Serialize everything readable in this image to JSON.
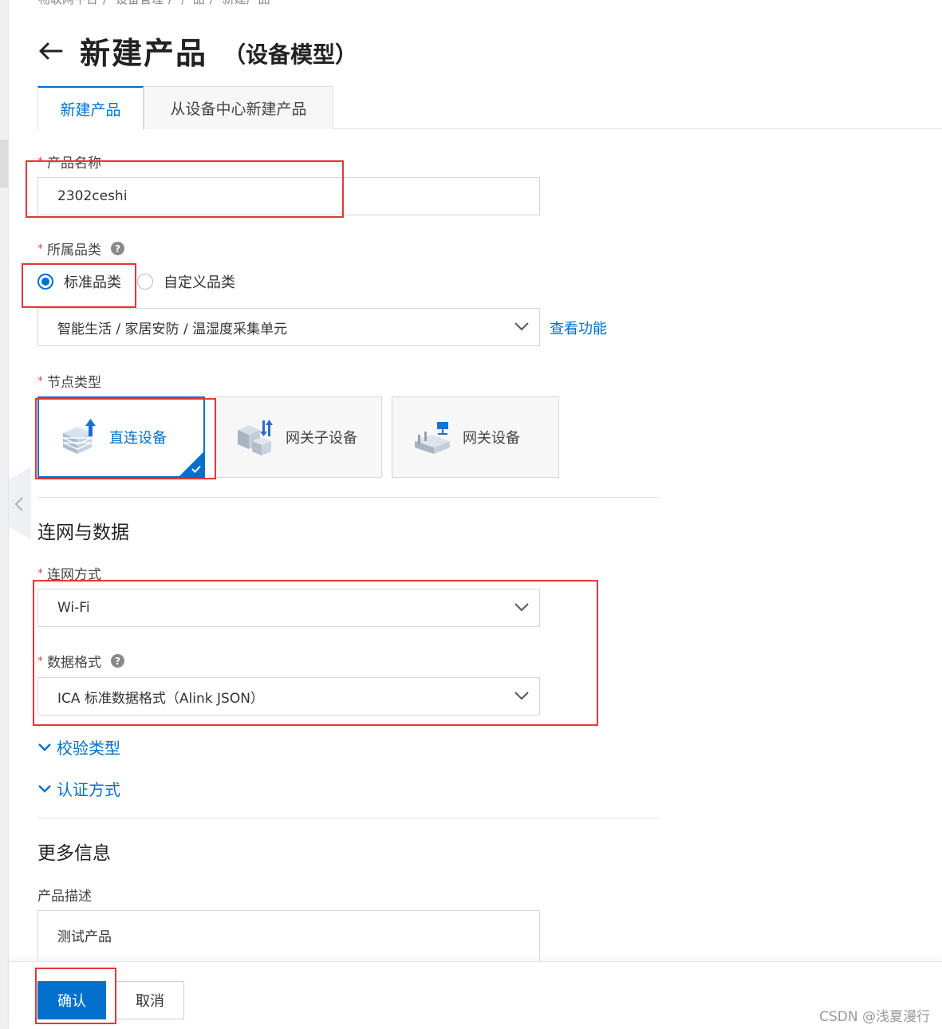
{
  "breadcrumb": [
    "物联网平台",
    "设备管理",
    "产品",
    "新建产品"
  ],
  "header": {
    "title": "新建产品",
    "subtitle": "（设备模型）"
  },
  "tabs": [
    {
      "label": "新建产品",
      "active": true
    },
    {
      "label": "从设备中心新建产品",
      "active": false
    }
  ],
  "form": {
    "product_name": {
      "label": "产品名称",
      "value": "2302ceshi"
    },
    "category": {
      "label": "所属品类",
      "options": [
        "标准品类",
        "自定义品类"
      ],
      "selected": "标准品类",
      "value": "智能生活 / 家居安防 / 温湿度采集单元",
      "link": "查看功能"
    },
    "node_type": {
      "label": "节点类型",
      "options": [
        "直连设备",
        "网关子设备",
        "网关设备"
      ],
      "selected": "直连设备"
    },
    "network_section": {
      "title": "连网与数据",
      "network_method": {
        "label": "连网方式",
        "value": "Wi-Fi"
      },
      "data_format": {
        "label": "数据格式",
        "value": "ICA 标准数据格式（Alink JSON）"
      },
      "verify_type": "校验类型",
      "auth_method": "认证方式"
    },
    "more_section": {
      "title": "更多信息",
      "description": {
        "label": "产品描述",
        "value": "测试产品"
      }
    }
  },
  "footer": {
    "confirm": "确认",
    "cancel": "取消"
  },
  "watermark": "CSDN @浅夏漫行",
  "colors": {
    "accent": "#0070cc",
    "required": "#e34b4b",
    "annotation": "#e3373a"
  }
}
